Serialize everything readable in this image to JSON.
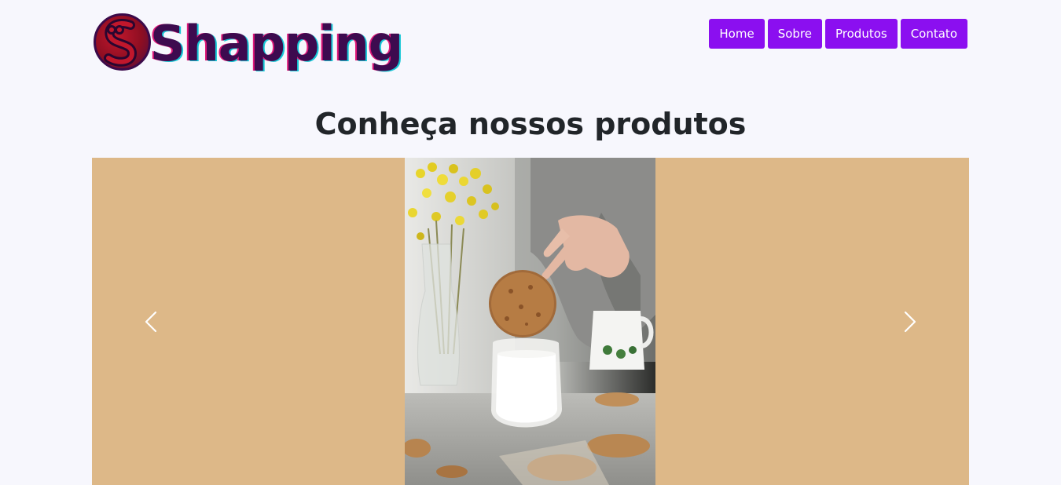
{
  "header": {
    "logo_text": "Shapping"
  },
  "nav": {
    "items": [
      "Home",
      "Sobre",
      "Produtos",
      "Contato"
    ]
  },
  "main": {
    "title": "Conheça nossos produtos"
  },
  "carousel": {
    "slide_description": "cookie dipped in milk",
    "prev_icon": "chevron-left-icon",
    "next_icon": "chevron-right-icon"
  },
  "colors": {
    "page_background": "#f7f7fd",
    "nav_button": "#8b0ff0",
    "carousel_background": "#ddb888",
    "logo_text": "#3d0b4f"
  }
}
